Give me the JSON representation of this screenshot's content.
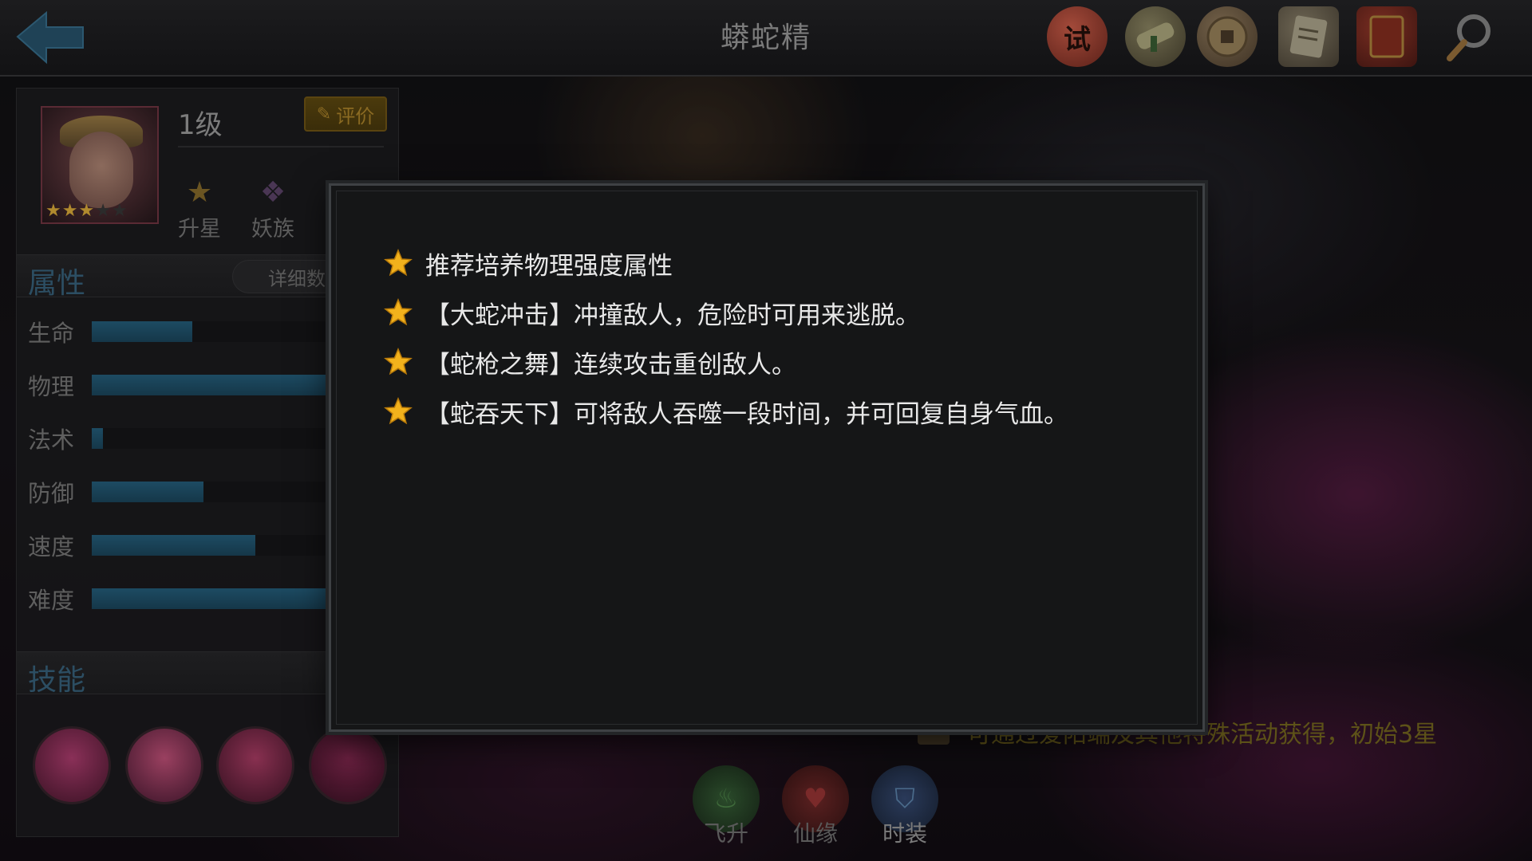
{
  "header": {
    "title": "蟒蛇精",
    "icons": [
      "trial-seal-icon",
      "scroll-icon",
      "coin-icon",
      "document-icon",
      "book-icon",
      "magnifier-icon"
    ],
    "trial_glyph": "试"
  },
  "hero": {
    "level": "1级",
    "star_rating": {
      "filled": 3,
      "total": 5
    },
    "rate_label": "评价",
    "upgrade_star_label": "升星",
    "race_label": "妖族"
  },
  "attributes": {
    "title": "属性",
    "detail_label": "详细数",
    "stats": [
      {
        "label": "生命",
        "value": 0.35
      },
      {
        "label": "物理",
        "value": 1.0
      },
      {
        "label": "法术",
        "value": 0.04
      },
      {
        "label": "防御",
        "value": 0.39
      },
      {
        "label": "速度",
        "value": 0.57
      },
      {
        "label": "难度",
        "value": 1.0
      }
    ]
  },
  "skills": {
    "title": "技能",
    "icons": [
      "snake-dancer-skill-icon",
      "spear-skill-icon",
      "serpent-skill-icon",
      "whirl-skill-icon"
    ]
  },
  "bottom_nav": {
    "ascend_label": "飞升",
    "fate_label": "仙缘",
    "costume_label": "时装"
  },
  "obtain_text": "可通过爱阳端及其他特殊活动获得，初始3星",
  "modal": {
    "tips": [
      "推荐培养物理强度属性",
      "【大蛇冲击】冲撞敌人，危险时可用来逃脱。",
      "【蛇枪之舞】连续攻击重创敌人。",
      "【蛇吞天下】可将敌人吞噬一段时间，并可回复自身气血。"
    ]
  },
  "colors": {
    "accent_gold": "#f2b21c",
    "stat_bar": "#1d4b63",
    "section_title": "#2c4e63"
  }
}
